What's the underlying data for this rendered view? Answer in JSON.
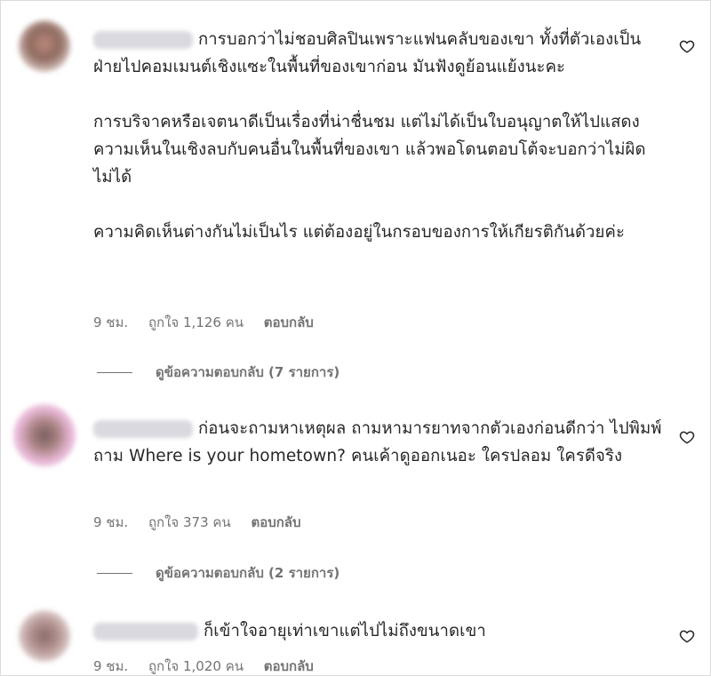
{
  "comments": [
    {
      "text": "การบอกว่าไม่ชอบศิลปินเพราะแฟนคลับของเขา ทั้งที่ตัวเองเป็นฝ่ายไปคอมเมนต์เชิงแซะในพื้นที่ของเขาก่อน มันฟังดูย้อนแย้งนะคะ\n\nการบริจาคหรือเจตนาดีเป็นเรื่องที่น่าชื่นชม แต่ไม่ได้เป็นใบอนุญาตให้ไปแสดงความเห็นในเชิงลบกับคนอื่นในพื้นที่ของเขา แล้วพอโดนตอบโต้จะบอกว่าไม่ผิดไม่ได้\n\nความคิดเห็นต่างกันไม่เป็นไร แต่ต้องอยู่ในกรอบของการให้เกียรติกันด้วยค่ะ",
      "time": "9 ชม.",
      "likes": "ถูกใจ 1,126 คน",
      "reply_label": "ตอบกลับ",
      "view_replies": "ดูข้อความตอบกลับ (7 รายการ)"
    },
    {
      "text": "ก่อนจะถามหาเหตุผล ถามหามารยาทจากตัวเองก่อนดีกว่า ไปพิมพ์ถาม Where is your hometown? คนเค้าดูออกเนอะ ใครปลอม ใครดีจริง",
      "time": "9 ชม.",
      "likes": "ถูกใจ 373 คน",
      "reply_label": "ตอบกลับ",
      "view_replies": "ดูข้อความตอบกลับ (2 รายการ)"
    },
    {
      "text": "ก็เข้าใจอายุเท่าเขาแต่ไปไม่ถึงขนาดเขา",
      "time": "9 ชม.",
      "likes": "ถูกใจ 1,020 คน",
      "reply_label": "ตอบกลับ"
    }
  ],
  "icons": {
    "like": "heart-outline-icon"
  }
}
